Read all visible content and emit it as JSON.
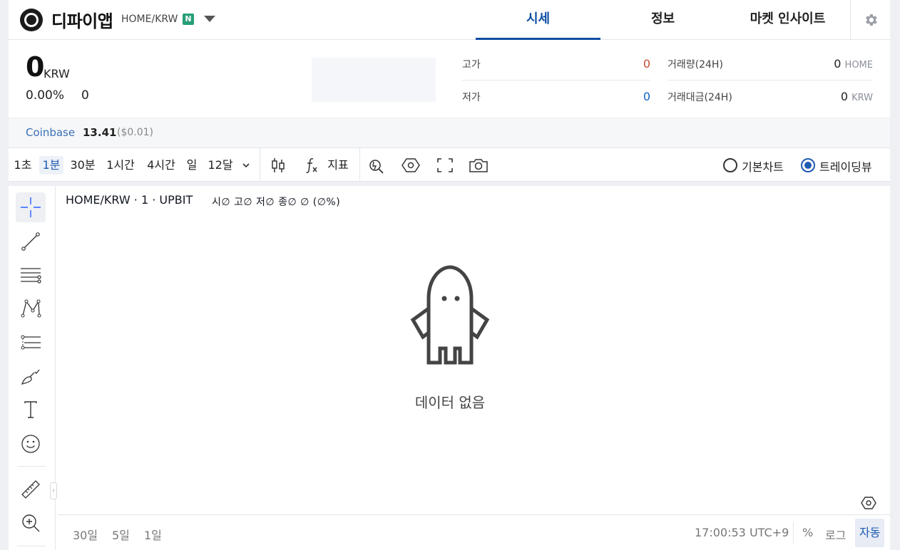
{
  "header": {
    "coin_name": "디파이앱",
    "pair": "HOME/KRW",
    "badge": "N",
    "tabs": [
      "시세",
      "정보",
      "마켓 인사이트"
    ],
    "active_tab": "시세"
  },
  "summary": {
    "price": "0",
    "price_unit": "KRW",
    "change_pct": "0.00%",
    "change_abs": "0",
    "high_label": "고가",
    "high_value": "0",
    "low_label": "저가",
    "low_value": "0",
    "volume_label": "거래량(24H)",
    "volume_value": "0",
    "volume_unit": "HOME",
    "amount_label": "거래대금(24H)",
    "amount_value": "0",
    "amount_unit": "KRW",
    "colors": {
      "high": "#c84a31",
      "low": "#1261c4"
    }
  },
  "coinbase": {
    "name": "Coinbase",
    "price": "13.41",
    "usd": "($0.01)"
  },
  "toolbar": {
    "timeframes": [
      "1초",
      "1분",
      "30분",
      "1시간",
      "4시간",
      "일",
      "12달"
    ],
    "active_timeframe": "1분",
    "indicator_label": "지표",
    "icons": [
      "chevron-down-icon",
      "candlestick-icon",
      "function-icon",
      "compare-icon",
      "hexagon-settings-icon",
      "fullscreen-icon",
      "camera-icon"
    ],
    "chart_modes": [
      "기본차트",
      "트레이딩뷰"
    ],
    "active_mode": "트레이딩뷰"
  },
  "drawing_tools": [
    "crosshair-icon",
    "trend-line-icon",
    "parallel-lines-icon",
    "pattern-icon",
    "fib-icon",
    "brush-icon",
    "text-icon",
    "emoji-icon",
    "ruler-icon",
    "zoom-in-icon"
  ],
  "chart": {
    "legend": "HOME/KRW · 1 · UPBIT",
    "ohlc": "시∅ 고∅ 저∅ 종∅ ∅ (∅%)",
    "empty_message": "데이터 없음",
    "ranges": [
      "30일",
      "5일",
      "1일"
    ],
    "clock": "17:00:53 UTC+9",
    "scale_buttons": [
      "%",
      "로그",
      "자동"
    ],
    "active_scale": "자동"
  }
}
